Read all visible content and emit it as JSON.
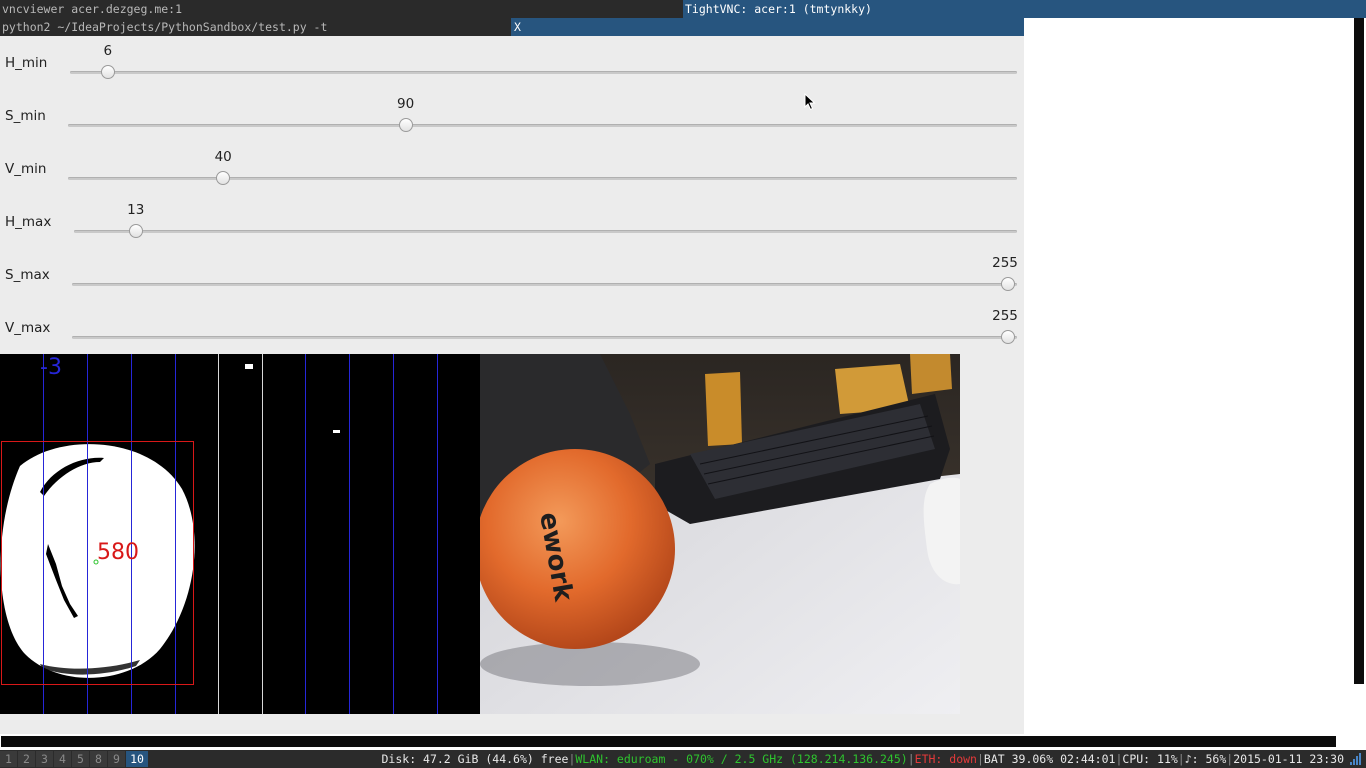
{
  "titlebars": {
    "top_left": "vncviewer acer.dezgeg.me:1",
    "top_right": "TightVNC: acer:1 (tmtynkky)",
    "second_left": "python2 ~/IdeaProjects/PythonSandbox/test.py -t",
    "second_right": "X"
  },
  "sliders": [
    {
      "label": "H_min",
      "value": "6",
      "fraction": 0.031
    },
    {
      "label": "S_min",
      "value": "90",
      "fraction": 0.353
    },
    {
      "label": "V_min",
      "value": "40",
      "fraction": 0.157
    },
    {
      "label": "H_max",
      "value": "13",
      "fraction": 0.057
    },
    {
      "label": "S_max",
      "value": "255",
      "fraction": 1.0
    },
    {
      "label": "V_max",
      "value": "255",
      "fraction": 1.0
    }
  ],
  "mask_view": {
    "offset_text": "-3",
    "area_text": "580"
  },
  "camera_view": {
    "ball_text": "ework"
  },
  "taskbar": {
    "workspaces": [
      {
        "label": "1",
        "active": false
      },
      {
        "label": "2",
        "active": false
      },
      {
        "label": "3",
        "active": false
      },
      {
        "label": "4",
        "active": false
      },
      {
        "label": "5",
        "active": false
      },
      {
        "label": "8",
        "active": false
      },
      {
        "label": "9",
        "active": false
      },
      {
        "label": "10",
        "active": true
      }
    ],
    "status": {
      "disk": "Disk: 47.2 GiB (44.6%) free",
      "wlan": "WLAN: eduroam - 070% / 2.5 GHz (128.214.136.245)",
      "eth": "ETH: down",
      "bat": "BAT 39.06% 02:44:01",
      "cpu": "CPU: 11%",
      "vol": "♪: 56%",
      "datetime": "2015-01-11 23:30"
    }
  },
  "colors": {
    "title_active": "#27557f",
    "title_inactive": "#2a2a2a",
    "window_bg": "#ececec",
    "wlan_green": "#2ec42e",
    "eth_red": "#e33a3a",
    "mask_lines": "#2626d8",
    "bbox_red": "#d81818",
    "ball_orange": "#e0662a"
  },
  "icons": [
    "cursor-icon",
    "signal-icon"
  ]
}
